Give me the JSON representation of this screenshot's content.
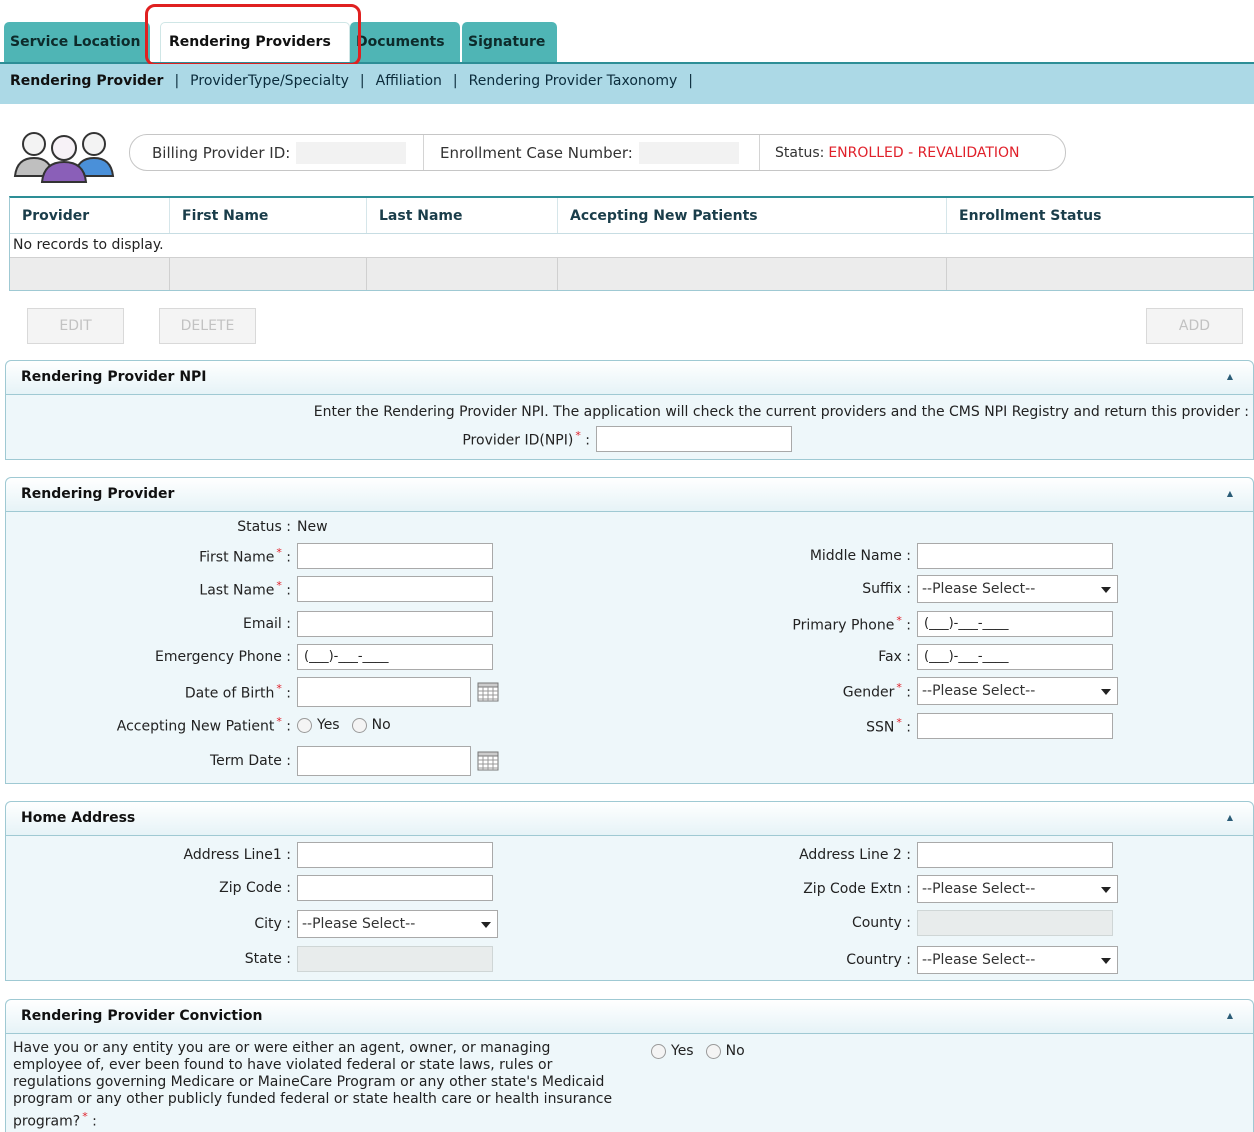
{
  "tabs": [
    {
      "label": "Service Location"
    },
    {
      "label": "Rendering Providers"
    },
    {
      "label": "Documents"
    },
    {
      "label": "Signature"
    }
  ],
  "subnav": {
    "items": [
      "Rendering Provider",
      "ProviderType/Specialty",
      "Affiliation",
      "Rendering Provider Taxonomy"
    ],
    "separator": "|"
  },
  "info": {
    "billing_label": "Billing Provider ID:",
    "case_label": "Enrollment Case Number:",
    "status_label": "Status:",
    "status_value": "ENROLLED - REVALIDATION"
  },
  "grid": {
    "columns": [
      "Provider",
      "First Name",
      "Last Name",
      "Accepting New Patients",
      "Enrollment Status"
    ],
    "empty_text": "No records to display."
  },
  "buttons": {
    "edit": "EDIT",
    "delete": "DELETE",
    "add": "ADD"
  },
  "npi_panel": {
    "title": "Rendering Provider NPI",
    "instruction": "Enter the Rendering Provider NPI. The application will check the current providers and the CMS NPI Registry and return this provider :",
    "provider_id_label": "Provider ID(NPI)"
  },
  "provider_panel": {
    "title": "Rendering Provider",
    "status_label": "Status :",
    "status_value": "New",
    "first_name": "First Name",
    "last_name": "Last Name",
    "email": "Email :",
    "emergency_phone": "Emergency Phone :",
    "emergency_phone_value": "(___)-___-____",
    "dob": "Date of Birth",
    "accepting": "Accepting New Patient",
    "yes": "Yes",
    "no": "No",
    "term_date": "Term Date :",
    "middle_name": "Middle Name :",
    "suffix": "Suffix :",
    "suffix_value": "--Please Select--",
    "primary_phone": "Primary Phone",
    "primary_phone_value": "(___)-___-____",
    "fax": "Fax :",
    "fax_value": "(___)-___-____",
    "gender": "Gender",
    "gender_value": "--Please Select--",
    "ssn": "SSN"
  },
  "address_panel": {
    "title": "Home Address",
    "address1": "Address Line1 :",
    "zip": "Zip Code :",
    "city": "City :",
    "city_value": "--Please Select--",
    "state": "State :",
    "address2": "Address Line 2 :",
    "zip_extn": "Zip Code Extn :",
    "zip_extn_value": "--Please Select--",
    "county": "County :",
    "country": "Country :",
    "country_value": "--Please Select--"
  },
  "conviction_panel": {
    "title": "Rendering Provider Conviction",
    "question": "Have you or any entity you are or were either an agent, owner, or managing employee of, ever been found to have violated federal or state laws, rules or regulations governing Medicare or MaineCare Program or any other state's Medicaid program or any other publicly funded federal or state health care or health insurance program?",
    "yes": "Yes",
    "no": "No"
  },
  "colors": {
    "tab": "#4fb5b5",
    "subnav": "#acd9e6",
    "status": "#e0202a",
    "highlight": "#e02020"
  }
}
